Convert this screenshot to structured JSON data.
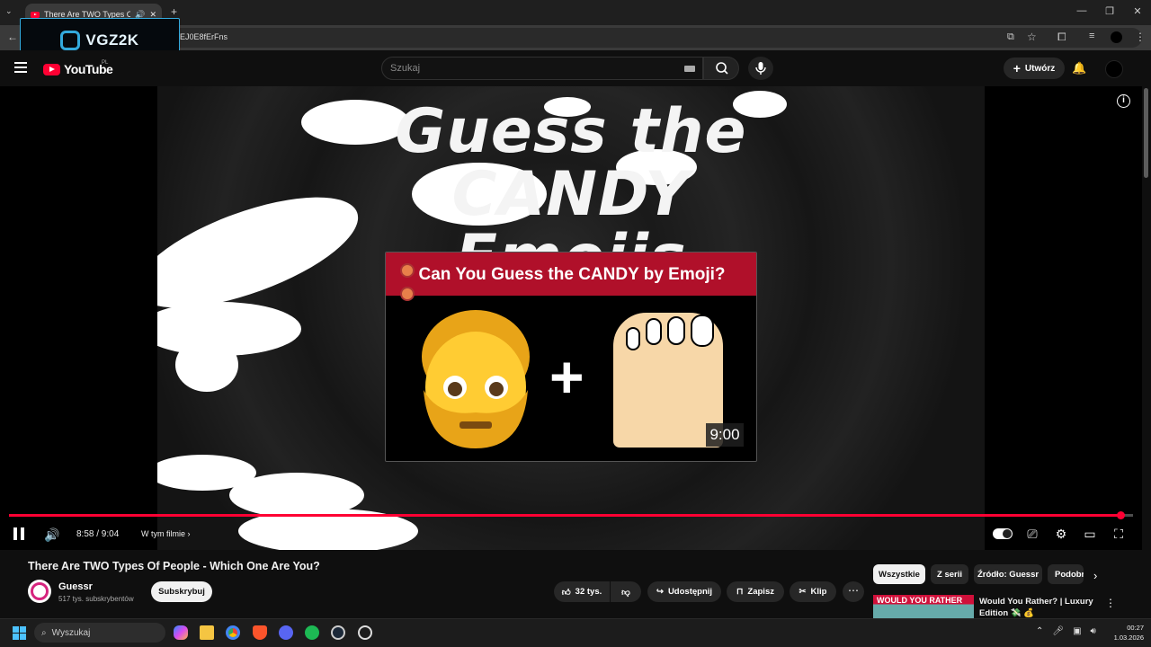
{
  "browser": {
    "tab_title": "There Are TWO Types Of P...",
    "new_tab": "+",
    "url": "EJ0E8fErFns",
    "window_controls": [
      "—",
      "❐",
      "✕"
    ]
  },
  "overlay": {
    "text": "VGZ2K"
  },
  "youtube": {
    "logo_text": "YouTube",
    "country": "PL",
    "search_placeholder": "Szukaj",
    "create_label": "Utwórz"
  },
  "video": {
    "title_line1": "Guess the CANDY",
    "title_line2": "Emojis",
    "card_title": "Can You Guess the CANDY by Emoji?",
    "card_duration": "9:00",
    "plus": "+"
  },
  "player": {
    "time": "8:58 / 9:04",
    "chapter": "W tym filmie",
    "progress": 0.989
  },
  "meta": {
    "title": "There Are TWO Types Of People - Which One Are You?",
    "channel": "Guessr",
    "subscribers": "517 tys. subskrybentów",
    "subscribe": "Subskrybuj",
    "likes": "32 tys.",
    "share": "Udostępnij",
    "save": "Zapisz",
    "clip": "Klip",
    "more": "⋯"
  },
  "chips": [
    "Wszystkie",
    "Z serii",
    "Źródło: Guessr",
    "Podobne"
  ],
  "recommendation": {
    "thumb_text": "WOULD YOU RATHER",
    "title": "Would You Rather? | Luxury Edition 💸 💰"
  },
  "taskbar": {
    "search": "Wyszukaj",
    "time": "00:27",
    "date": "1.03.2026"
  },
  "colors": {
    "accent": "#ff0033",
    "background": "#0f0f0f"
  }
}
